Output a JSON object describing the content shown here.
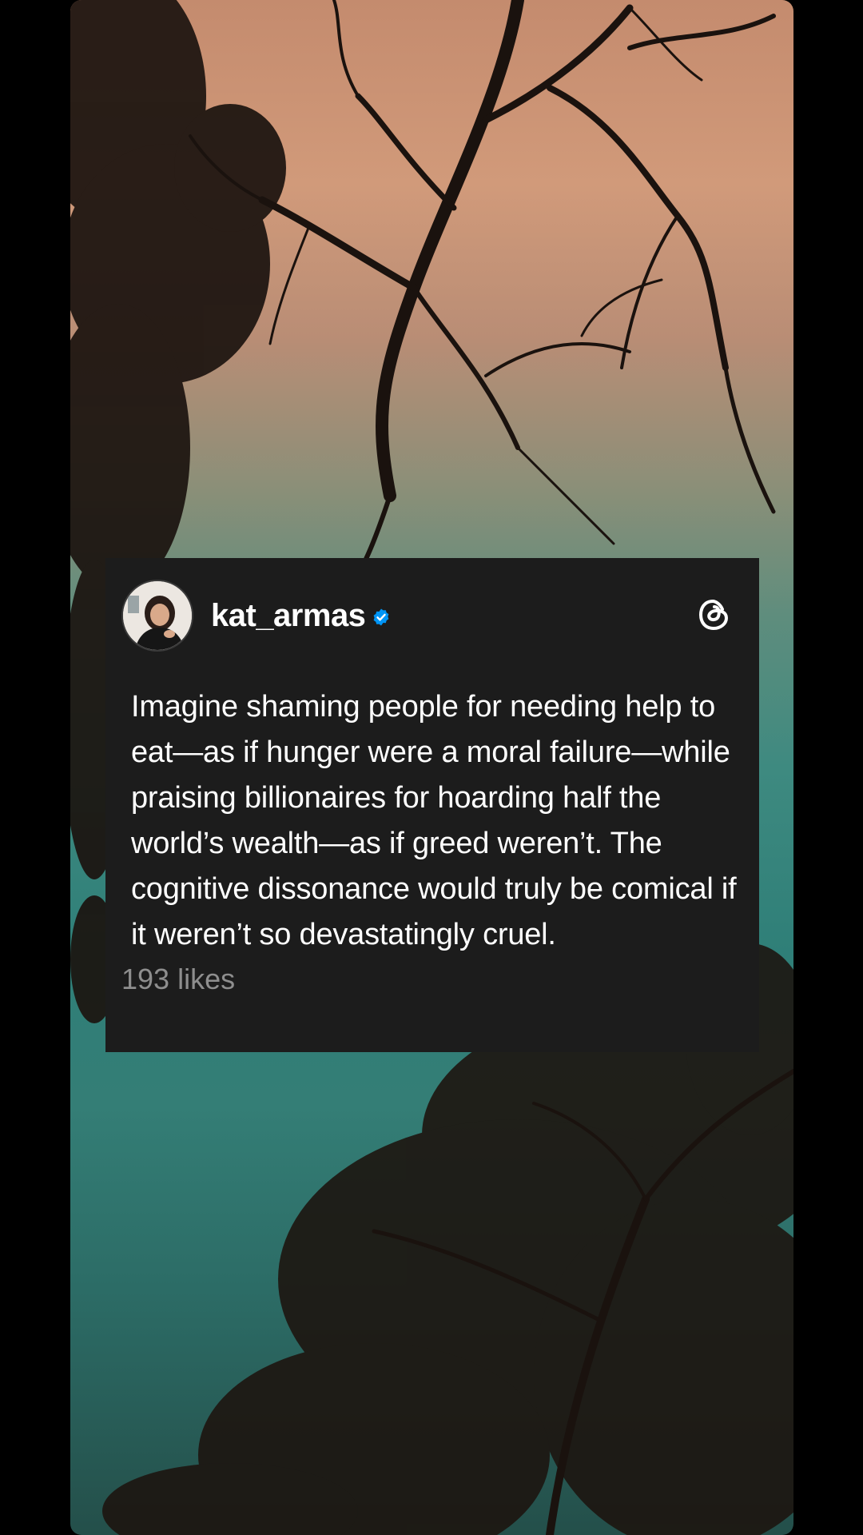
{
  "post": {
    "username": "kat_armas",
    "verified": true,
    "text": "Imagine shaming people for needing help to eat—as if hunger were a moral failure—while praising billionaires for hoarding half the world’s wealth—as if greed weren’t. The cognitive dissonance would truly be comical if it weren’t so devastatingly cruel.",
    "likes": "193 likes",
    "app_icon": "threads-logo-icon",
    "verified_icon": "verified-badge-icon",
    "avatar": "avatar"
  },
  "colors": {
    "card_background": "#1c1c1c",
    "text_primary": "#ffffff",
    "text_secondary": "#8e8e8e",
    "verified_blue": "#0095f6",
    "screen_background": "#000000"
  }
}
